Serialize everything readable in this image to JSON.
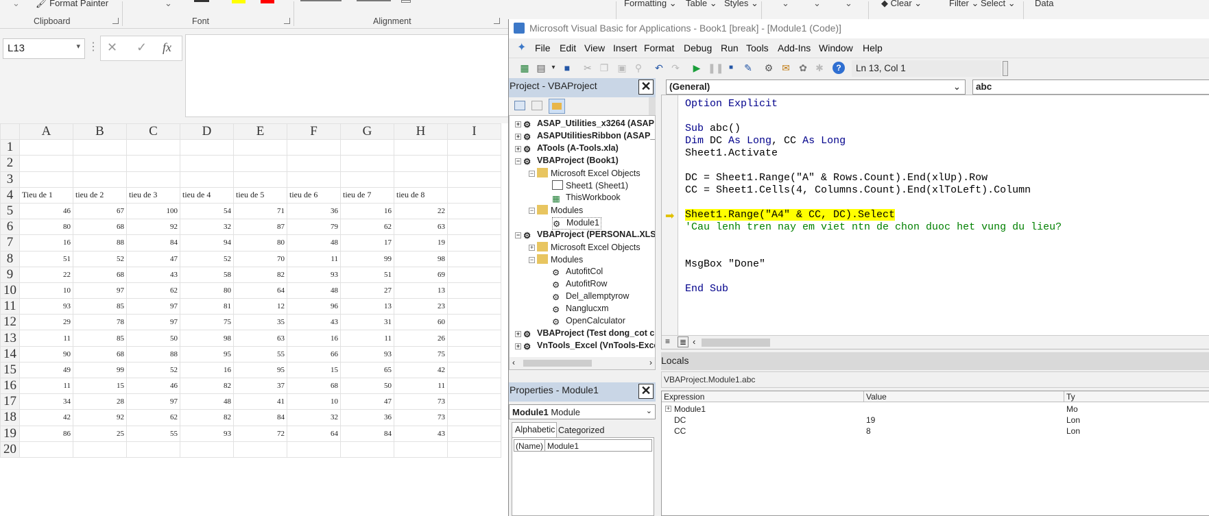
{
  "ribbon": {
    "format_painter": "Format Painter",
    "formatting": "Formatting",
    "table": "Table",
    "styles": "Styles",
    "clear": "Clear",
    "filter": "Filter",
    "select": "Select",
    "data": "Data",
    "groups": {
      "clipboard": "Clipboard",
      "font": "Font",
      "alignment": "Alignment"
    }
  },
  "formula_bar": {
    "name_box": "L13",
    "cancel_icon": "✕",
    "enter_icon": "✓",
    "fx_icon": "fx",
    "content": ""
  },
  "sheet": {
    "columns": [
      "A",
      "B",
      "C",
      "D",
      "E",
      "F",
      "G",
      "H",
      "I"
    ],
    "row_numbers": [
      "1",
      "2",
      "3",
      "4",
      "5",
      "6",
      "7",
      "8",
      "9",
      "10",
      "11",
      "12",
      "13",
      "14",
      "15",
      "16",
      "17",
      "18",
      "19",
      "20"
    ],
    "headers": [
      "Tieu de 1",
      "tieu de 2",
      "tieu de 3",
      "tieu de 4",
      "tieu de 5",
      "tieu de 6",
      "tieu de 7",
      "tieu de 8"
    ],
    "rows": [
      [
        46,
        67,
        100,
        54,
        71,
        36,
        16,
        22
      ],
      [
        80,
        68,
        92,
        32,
        87,
        79,
        62,
        63
      ],
      [
        16,
        88,
        84,
        94,
        80,
        48,
        17,
        19
      ],
      [
        51,
        52,
        47,
        52,
        70,
        11,
        99,
        98
      ],
      [
        22,
        68,
        43,
        58,
        82,
        93,
        51,
        69
      ],
      [
        10,
        97,
        62,
        80,
        64,
        48,
        27,
        13
      ],
      [
        93,
        85,
        97,
        81,
        12,
        96,
        13,
        23
      ],
      [
        29,
        78,
        97,
        75,
        35,
        43,
        31,
        60
      ],
      [
        11,
        85,
        50,
        98,
        63,
        16,
        11,
        26
      ],
      [
        90,
        68,
        88,
        95,
        55,
        66,
        93,
        75
      ],
      [
        49,
        99,
        52,
        16,
        95,
        15,
        65,
        42
      ],
      [
        11,
        15,
        46,
        82,
        37,
        68,
        50,
        11
      ],
      [
        34,
        28,
        97,
        48,
        41,
        10,
        47,
        73
      ],
      [
        42,
        92,
        62,
        82,
        84,
        32,
        36,
        73
      ],
      [
        86,
        25,
        55,
        93,
        72,
        64,
        84,
        43
      ]
    ]
  },
  "vba": {
    "title": "Microsoft Visual Basic for Applications - Book1 [break] - [Module1 (Code)]",
    "menu": [
      "File",
      "Edit",
      "View",
      "Insert",
      "Format",
      "Debug",
      "Run",
      "Tools",
      "Add-Ins",
      "Window",
      "Help"
    ],
    "status": "Ln 13, Col 1",
    "project_title": "Project - VBAProject",
    "tree": {
      "asap": "ASAP_Utilities_x3264 (ASAP",
      "asap_ribbon": "ASAPUtilitiesRibbon (ASAP_U",
      "atools": "ATools (A-Tools.xla)",
      "vbaproject_book1": "VBAProject (Book1)",
      "excel_objects": "Microsoft Excel Objects",
      "sheet1": "Sheet1 (Sheet1)",
      "thisworkbook": "ThisWorkbook",
      "modules": "Modules",
      "module1": "Module1",
      "vbaproject_personal": "VBAProject (PERSONAL.XLSB",
      "excel_objects2": "Microsoft Excel Objects",
      "modules2": "Modules",
      "autofitcol": "AutofitCol",
      "autofitrow": "AutofitRow",
      "del_allemptyrow": "Del_allemptyrow",
      "nanglucxm": "Nanglucxm",
      "opencalculator": "OpenCalculator",
      "vbaproject_test": "VBAProject (Test dong_cot c",
      "vntools": "VnTools_Excel (VnTools-Excel"
    },
    "properties_title": "Properties - Module1",
    "properties_object": "Module1",
    "properties_object_type": "Module",
    "properties_tabs": [
      "Alphabetic",
      "Categorized"
    ],
    "properties_row": {
      "name": "(Name)",
      "value": "Module1"
    },
    "combo_general": "(General)",
    "combo_proc": "abc",
    "code": {
      "l1": "Option Explicit",
      "l3a": "Sub",
      "l3b": " abc()",
      "l4a": "Dim",
      "l4b": " DC ",
      "l4c": "As Long",
      "l4d": ", CC ",
      "l4e": "As Long",
      "l5": "Sheet1.Activate",
      "l7": "DC = Sheet1.Range(\"A\" & Rows.Count).End(xlUp).Row",
      "l8": "CC = Sheet1.Cells(4, Columns.Count).End(xlToLeft).Column",
      "l10": "Sheet1.Range(\"A4\" & CC, DC).Select",
      "l11": "'Cau lenh tren nay em viet ntn de chon duoc het vung du lieu?",
      "l14": "MsgBox \"Done\"",
      "l16": "End Sub"
    },
    "locals_title": "Locals",
    "locals_context": "VBAProject.Module1.abc",
    "locals_headers": [
      "Expression",
      "Value",
      "Ty"
    ],
    "locals_rows": [
      {
        "expr": "Module1",
        "value": "",
        "type": "Mo"
      },
      {
        "expr": "DC",
        "value": "19",
        "type": "Lon"
      },
      {
        "expr": "CC",
        "value": "8",
        "type": "Lon"
      }
    ]
  }
}
